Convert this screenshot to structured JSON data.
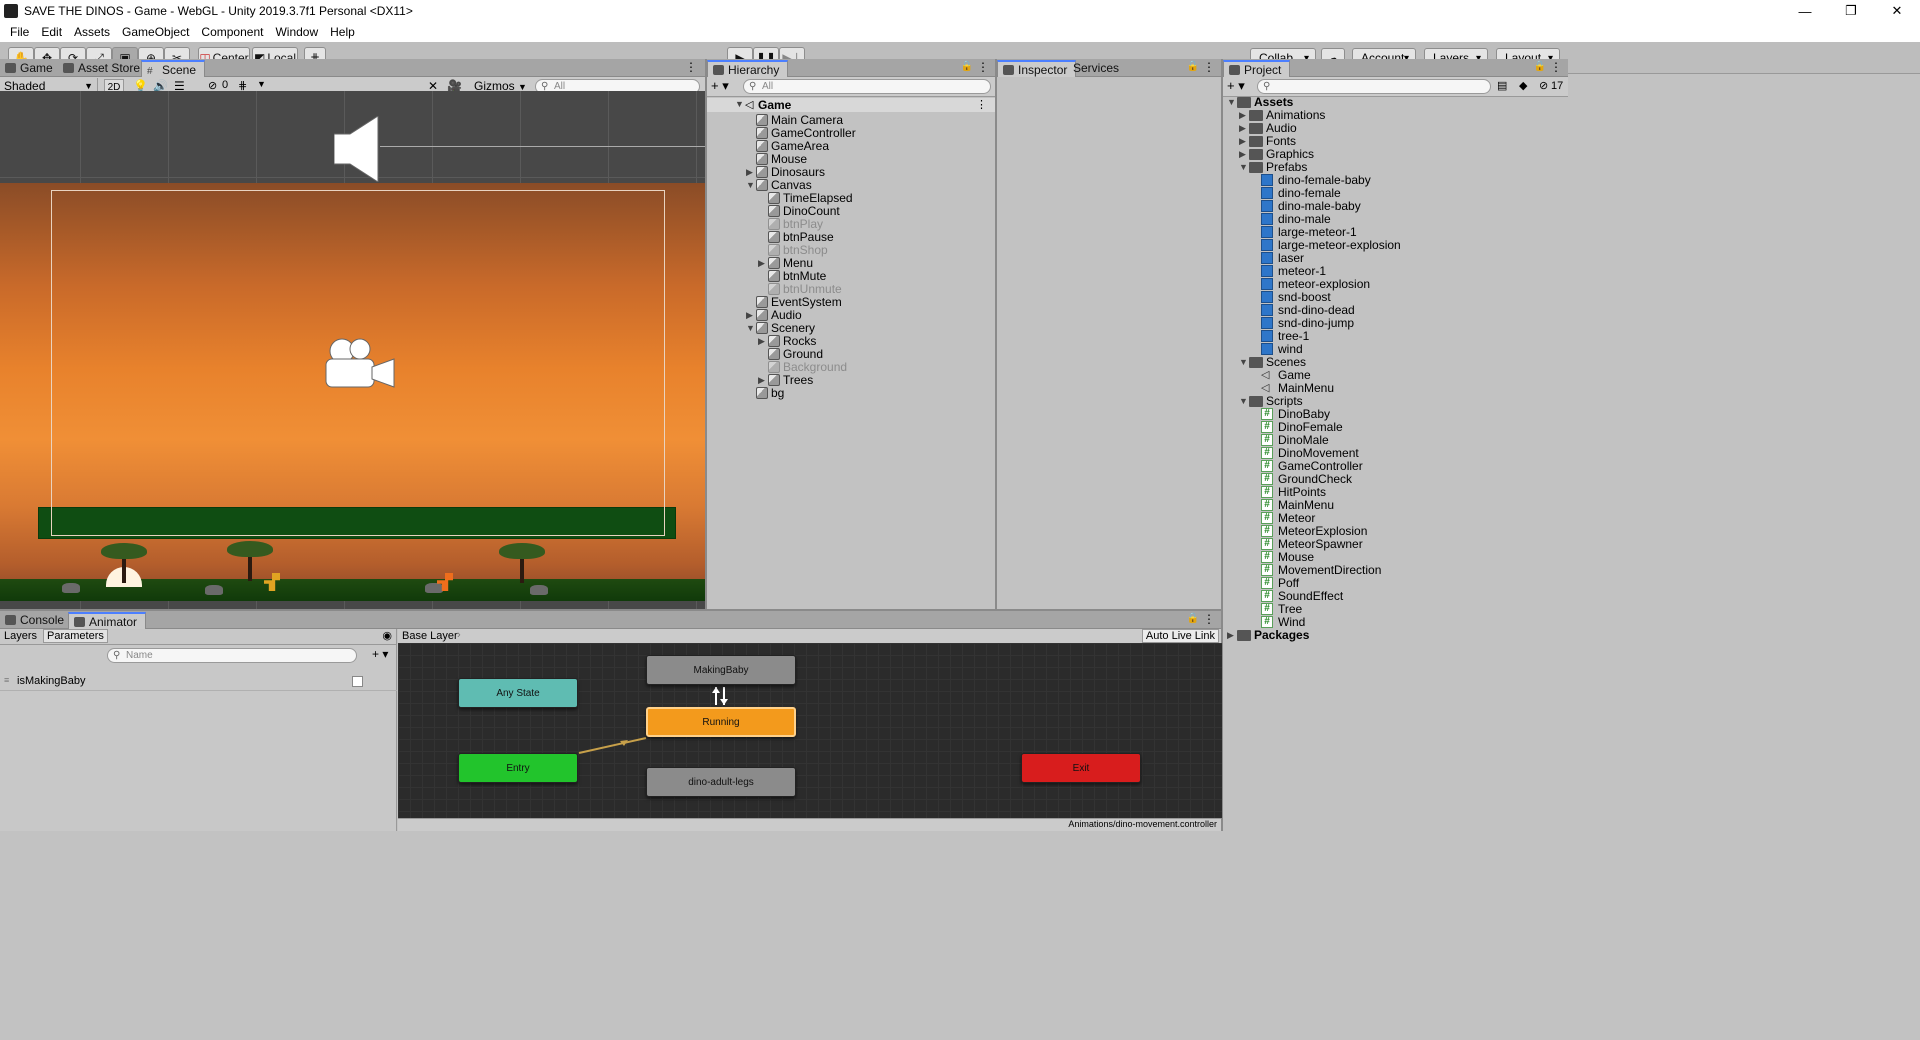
{
  "window": {
    "title": "SAVE THE DINOS - Game - WebGL - Unity 2019.3.7f1 Personal <DX11>",
    "minimize": "—",
    "restore": "❐",
    "close": "✕"
  },
  "menu": [
    "File",
    "Edit",
    "Assets",
    "GameObject",
    "Component",
    "Window",
    "Help"
  ],
  "toolbar": {
    "pivot": "Center",
    "space": "Local",
    "collab": "Collab",
    "account": "Account",
    "layers": "Layers",
    "layout": "Layout"
  },
  "scene_panel": {
    "tabs": [
      "Game",
      "Asset Store",
      "Scene"
    ],
    "shading": "Shaded",
    "mode2d": "2D",
    "hidden_count": "0",
    "gizmos": "Gizmos",
    "search_placeholder": "All"
  },
  "hierarchy": {
    "tab": "Hierarchy",
    "search_placeholder": "All",
    "scene": "Game",
    "items": [
      {
        "label": "Main Camera",
        "depth": 1,
        "arrow": "",
        "disabled": false
      },
      {
        "label": "GameController",
        "depth": 1,
        "arrow": "",
        "disabled": false
      },
      {
        "label": "GameArea",
        "depth": 1,
        "arrow": "",
        "disabled": false
      },
      {
        "label": "Mouse",
        "depth": 1,
        "arrow": "",
        "disabled": false
      },
      {
        "label": "Dinosaurs",
        "depth": 1,
        "arrow": "▶",
        "disabled": false
      },
      {
        "label": "Canvas",
        "depth": 1,
        "arrow": "▼",
        "disabled": false
      },
      {
        "label": "TimeElapsed",
        "depth": 2,
        "arrow": "",
        "disabled": false
      },
      {
        "label": "DinoCount",
        "depth": 2,
        "arrow": "",
        "disabled": false
      },
      {
        "label": "btnPlay",
        "depth": 2,
        "arrow": "",
        "disabled": true
      },
      {
        "label": "btnPause",
        "depth": 2,
        "arrow": "",
        "disabled": false
      },
      {
        "label": "btnShop",
        "depth": 2,
        "arrow": "",
        "disabled": true
      },
      {
        "label": "Menu",
        "depth": 2,
        "arrow": "▶",
        "disabled": false
      },
      {
        "label": "btnMute",
        "depth": 2,
        "arrow": "",
        "disabled": false
      },
      {
        "label": "btnUnmute",
        "depth": 2,
        "arrow": "",
        "disabled": true
      },
      {
        "label": "EventSystem",
        "depth": 1,
        "arrow": "",
        "disabled": false
      },
      {
        "label": "Audio",
        "depth": 1,
        "arrow": "▶",
        "disabled": false
      },
      {
        "label": "Scenery",
        "depth": 1,
        "arrow": "▼",
        "disabled": false
      },
      {
        "label": "Rocks",
        "depth": 2,
        "arrow": "▶",
        "disabled": false
      },
      {
        "label": "Ground",
        "depth": 2,
        "arrow": "",
        "disabled": false
      },
      {
        "label": "Background",
        "depth": 2,
        "arrow": "",
        "disabled": true
      },
      {
        "label": "Trees",
        "depth": 2,
        "arrow": "▶",
        "disabled": false
      },
      {
        "label": "bg",
        "depth": 1,
        "arrow": "",
        "disabled": false
      }
    ]
  },
  "inspector": {
    "tabs": [
      "Inspector",
      "Services"
    ]
  },
  "project": {
    "tab": "Project",
    "hidden_count": "17",
    "items": [
      {
        "label": "Assets",
        "depth": 0,
        "arrow": "▼",
        "type": "folder",
        "bold": true
      },
      {
        "label": "Animations",
        "depth": 1,
        "arrow": "▶",
        "type": "folder"
      },
      {
        "label": "Audio",
        "depth": 1,
        "arrow": "▶",
        "type": "folder"
      },
      {
        "label": "Fonts",
        "depth": 1,
        "arrow": "▶",
        "type": "folder"
      },
      {
        "label": "Graphics",
        "depth": 1,
        "arrow": "▶",
        "type": "folder"
      },
      {
        "label": "Prefabs",
        "depth": 1,
        "arrow": "▼",
        "type": "folder"
      },
      {
        "label": "dino-female-baby",
        "depth": 2,
        "arrow": "",
        "type": "prefab"
      },
      {
        "label": "dino-female",
        "depth": 2,
        "arrow": "",
        "type": "prefab"
      },
      {
        "label": "dino-male-baby",
        "depth": 2,
        "arrow": "",
        "type": "prefab"
      },
      {
        "label": "dino-male",
        "depth": 2,
        "arrow": "",
        "type": "prefab"
      },
      {
        "label": "large-meteor-1",
        "depth": 2,
        "arrow": "",
        "type": "prefab"
      },
      {
        "label": "large-meteor-explosion",
        "depth": 2,
        "arrow": "",
        "type": "prefab"
      },
      {
        "label": "laser",
        "depth": 2,
        "arrow": "",
        "type": "prefab"
      },
      {
        "label": "meteor-1",
        "depth": 2,
        "arrow": "",
        "type": "prefab"
      },
      {
        "label": "meteor-explosion",
        "depth": 2,
        "arrow": "",
        "type": "prefab"
      },
      {
        "label": "snd-boost",
        "depth": 2,
        "arrow": "",
        "type": "prefab"
      },
      {
        "label": "snd-dino-dead",
        "depth": 2,
        "arrow": "",
        "type": "prefab"
      },
      {
        "label": "snd-dino-jump",
        "depth": 2,
        "arrow": "",
        "type": "prefab"
      },
      {
        "label": "tree-1",
        "depth": 2,
        "arrow": "",
        "type": "prefab"
      },
      {
        "label": "wind",
        "depth": 2,
        "arrow": "",
        "type": "prefab"
      },
      {
        "label": "Scenes",
        "depth": 1,
        "arrow": "▼",
        "type": "folder"
      },
      {
        "label": "Game",
        "depth": 2,
        "arrow": "",
        "type": "scene"
      },
      {
        "label": "MainMenu",
        "depth": 2,
        "arrow": "",
        "type": "scene"
      },
      {
        "label": "Scripts",
        "depth": 1,
        "arrow": "▼",
        "type": "folder"
      },
      {
        "label": "DinoBaby",
        "depth": 2,
        "arrow": "",
        "type": "script"
      },
      {
        "label": "DinoFemale",
        "depth": 2,
        "arrow": "",
        "type": "script"
      },
      {
        "label": "DinoMale",
        "depth": 2,
        "arrow": "",
        "type": "script"
      },
      {
        "label": "DinoMovement",
        "depth": 2,
        "arrow": "",
        "type": "script"
      },
      {
        "label": "GameController",
        "depth": 2,
        "arrow": "",
        "type": "script"
      },
      {
        "label": "GroundCheck",
        "depth": 2,
        "arrow": "",
        "type": "script"
      },
      {
        "label": "HitPoints",
        "depth": 2,
        "arrow": "",
        "type": "script"
      },
      {
        "label": "MainMenu",
        "depth": 2,
        "arrow": "",
        "type": "script"
      },
      {
        "label": "Meteor",
        "depth": 2,
        "arrow": "",
        "type": "script"
      },
      {
        "label": "MeteorExplosion",
        "depth": 2,
        "arrow": "",
        "type": "script"
      },
      {
        "label": "MeteorSpawner",
        "depth": 2,
        "arrow": "",
        "type": "script"
      },
      {
        "label": "Mouse",
        "depth": 2,
        "arrow": "",
        "type": "script"
      },
      {
        "label": "MovementDirection",
        "depth": 2,
        "arrow": "",
        "type": "script"
      },
      {
        "label": "Poff",
        "depth": 2,
        "arrow": "",
        "type": "script"
      },
      {
        "label": "SoundEffect",
        "depth": 2,
        "arrow": "",
        "type": "script"
      },
      {
        "label": "Tree",
        "depth": 2,
        "arrow": "",
        "type": "script"
      },
      {
        "label": "Wind",
        "depth": 2,
        "arrow": "",
        "type": "script"
      },
      {
        "label": "Packages",
        "depth": 0,
        "arrow": "▶",
        "type": "folder",
        "bold": true
      }
    ]
  },
  "animator": {
    "tabs": [
      "Console",
      "Animator"
    ],
    "subtabs": [
      "Layers",
      "Parameters"
    ],
    "name_placeholder": "Name",
    "parameter": "isMakingBaby",
    "breadcrumb": "Base Layer",
    "auto_live_link": "Auto Live Link",
    "footer_path": "Animations/dino-movement.controller",
    "states": {
      "any": "Any State",
      "making_baby": "MakingBaby",
      "running": "Running",
      "entry": "Entry",
      "adult_legs": "dino-adult-legs",
      "exit": "Exit"
    },
    "colors": {
      "any": "#5fbcb2",
      "running": "#f39a1c",
      "entry": "#22c42c",
      "exit": "#d81d1d",
      "default": "#8b8b8b"
    }
  }
}
